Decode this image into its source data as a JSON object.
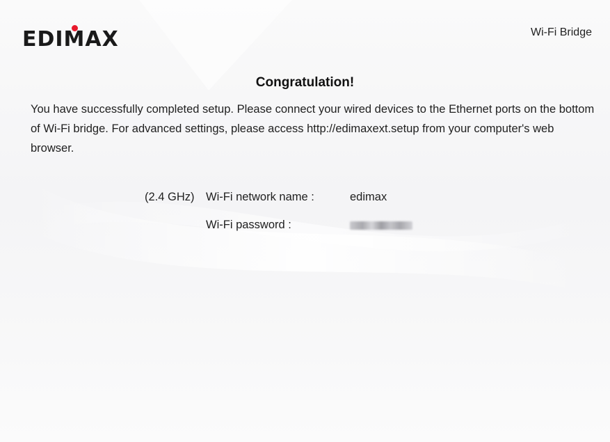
{
  "header": {
    "brand": "EDIMAX",
    "product": "Wi-Fi Bridge"
  },
  "main": {
    "title": "Congratulation!",
    "message": "You have successfully completed setup. Please connect your wired devices to the Ethernet ports on the bottom of Wi-Fi bridge. For advanced settings, please access http://edimaxext.setup from your computer's web browser.",
    "network": {
      "band": "(2.4 GHz)",
      "ssid_label": "Wi-Fi network name :",
      "ssid_value": "edimax",
      "password_label": "Wi-Fi password :",
      "password_value": "••••••••"
    }
  },
  "colors": {
    "brand_dot": "#e8192c",
    "text": "#1f1f1f"
  }
}
